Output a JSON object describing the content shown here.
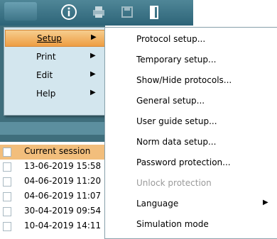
{
  "toolbar": {
    "menu_button_label": "",
    "icons": [
      "info-icon",
      "print-icon",
      "save-icon",
      "exit-icon"
    ]
  },
  "main_menu": {
    "items": [
      {
        "label": "Setup",
        "active": true
      },
      {
        "label": "Print",
        "active": false
      },
      {
        "label": "Edit",
        "active": false
      },
      {
        "label": "Help",
        "active": false
      }
    ],
    "arrow": "▶"
  },
  "sub_menu": {
    "items": [
      {
        "label": "Protocol setup...",
        "disabled": false
      },
      {
        "label": "Temporary setup...",
        "disabled": false
      },
      {
        "label": "Show/Hide protocols...",
        "disabled": false
      },
      {
        "label": "General setup...",
        "disabled": false
      },
      {
        "label": "User guide setup...",
        "disabled": false
      },
      {
        "label": "Norm data setup...",
        "disabled": false
      },
      {
        "label": "Password protection...",
        "disabled": false
      },
      {
        "label": "Unlock protection",
        "disabled": true
      },
      {
        "label": "Language",
        "disabled": false,
        "has_submenu": true
      },
      {
        "label": "Simulation mode",
        "disabled": false
      }
    ],
    "arrow": "▶"
  },
  "sessions": {
    "header": "Current session",
    "rows": [
      "13-06-2019 15:58",
      "04-06-2019 11:20",
      "04-06-2019 11:07",
      "30-04-2019 09:54",
      "10-04-2019 14:11"
    ]
  },
  "colors": {
    "toolbar": "#3f7587",
    "highlight": "#ee9e43",
    "menu_bg": "#d3e6ee",
    "disabled_text": "#9a9a9a"
  }
}
